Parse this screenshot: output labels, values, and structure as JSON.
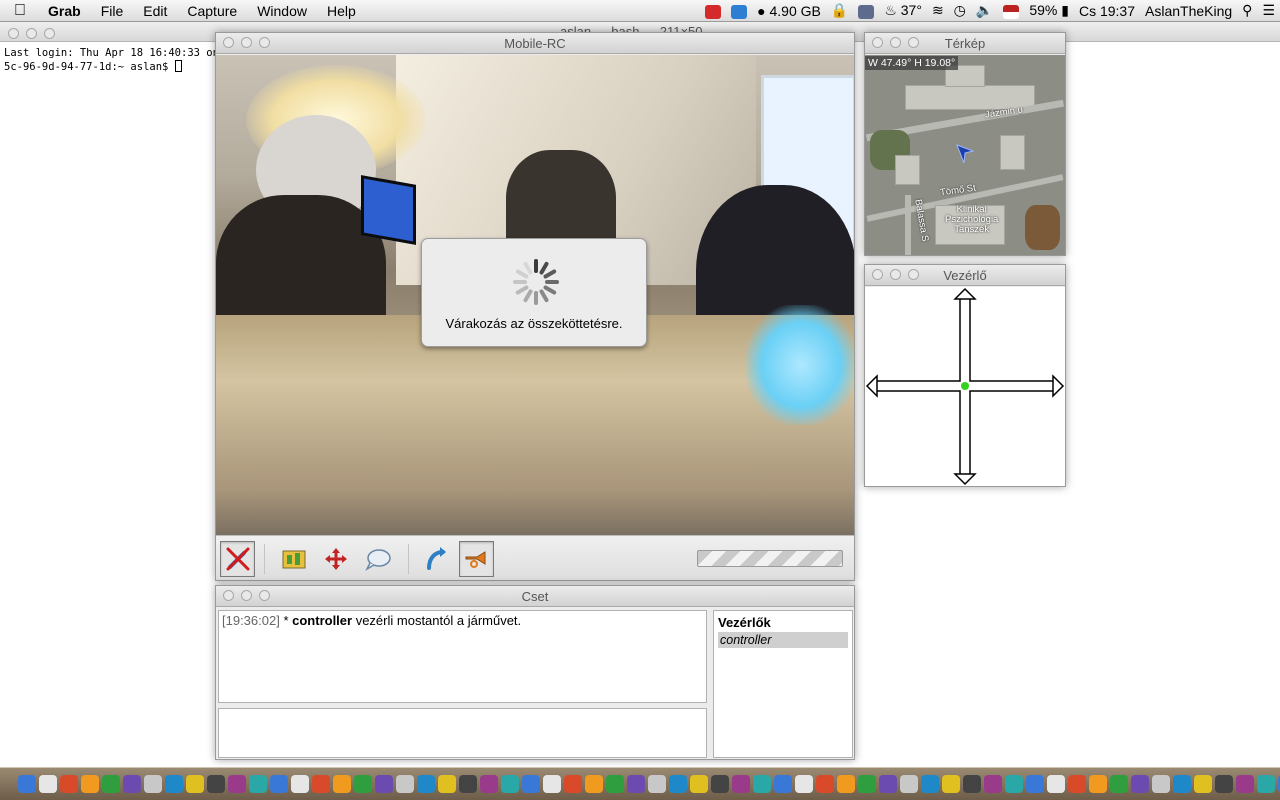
{
  "menubar": {
    "app_name": "Grab",
    "menus": [
      "File",
      "Edit",
      "Capture",
      "Window",
      "Help"
    ],
    "memory": "4.90 GB",
    "temperature": "37°",
    "battery": "59%",
    "clock": "Cs 19:37",
    "user": "AslanTheKing"
  },
  "terminal": {
    "title": "aslan — bash — 211×50",
    "line1": "Last login: Thu Apr 18 16:40:33 on",
    "line2": "5c-96-9d-94-77-1d:~ aslan$ "
  },
  "mobile_rc": {
    "title": "Mobile-RC",
    "wait_text": "Várakozás az összeköttetésre."
  },
  "terkep": {
    "title": "Térkép",
    "coords": "W 47.49° H 19.08°",
    "street1": "Jázmin u",
    "street2": "Tömő St",
    "street3": "Balassa S",
    "place": "Klinikai\nPszichológia\nTanszék"
  },
  "vezerlo": {
    "title": "Vezérlő"
  },
  "cset": {
    "title": "Cset",
    "message": {
      "time": "[19:36:02]",
      "prefix": "* ",
      "user": "controller",
      "text": " vezérli mostantól a járművet."
    },
    "users_header": "Vezérlők",
    "users": [
      "controller"
    ]
  },
  "colors": {
    "accent_blue": "#2f7fc4",
    "joystick_center": "#34d11f",
    "map_marker": "#1d3fa8"
  }
}
